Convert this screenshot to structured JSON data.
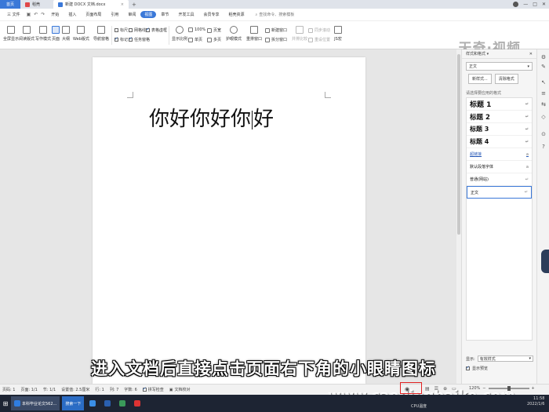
{
  "titlebar": {
    "home_tab": "首页",
    "pdf_tab": "稻壳",
    "doc_tab": "新建 DOCX 文档.docx",
    "close_tab": "×",
    "new_tab": "+",
    "min": "—",
    "max": "□",
    "close": "✕"
  },
  "menubar": {
    "file": "三 文件",
    "items": [
      "开始",
      "插入",
      "页面布局",
      "引用",
      "审阅",
      "视图",
      "章节",
      "开发工具",
      "会员专享",
      "稻壳资源"
    ],
    "active_index": 5,
    "search": "查找命令、搜索模板",
    "right_items": [
      "未同步",
      "协作",
      "分享"
    ]
  },
  "ribbon": {
    "full_screen": "全屏显示",
    "reading_mode": "阅读版式",
    "write_mode": "写作模式",
    "page_view": "页面",
    "outline": "大纲",
    "web_layout": "Web版式",
    "nav_pane": "导航窗格",
    "ruler": "标尺",
    "gridlines": "网格线",
    "table_gridlines": "表格虚框",
    "markup": "标记",
    "task_pane": "任务窗格",
    "zoom": "显示比例",
    "zoom_100": "100%",
    "one_page": "单页",
    "multi_page": "多页",
    "page_width": "页宽",
    "eye_protect": "护眼模式",
    "rearrange": "重排窗口",
    "new_window": "新建窗口",
    "split_window": "拆分窗口",
    "side_by_side": "并排比较",
    "sync_scroll": "同步滚动",
    "reset_pos": "重设位置",
    "macro": "JS宏"
  },
  "watermark": "天奇·视频",
  "document": {
    "text_before": "你好你好你",
    "text_after": "好"
  },
  "subtitle": "进入文档后直接点击页面右下角的小眼睛图标",
  "url_overlay": "www.caodingbaike.com",
  "styles_panel": {
    "title": "样式和格式 ▾",
    "current_style": "正文",
    "new_style": "新样式...",
    "clear_format": "清除格式",
    "list_label": "请选择要应用的格式",
    "items": [
      {
        "label": "标题 1"
      },
      {
        "label": "标题 2"
      },
      {
        "label": "标题 3"
      },
      {
        "label": "标题 4"
      },
      {
        "label": "超链接"
      },
      {
        "label": "默认段落字体"
      },
      {
        "label": "普通(网站)"
      },
      {
        "label": "正文"
      }
    ],
    "return_mark": "↵",
    "para_mark": "a",
    "show_label": "显示:",
    "show_value": "有效样式",
    "preview_label": "显示预览"
  },
  "statusbar": {
    "page_num": "页码: 1",
    "pages": "页面: 1/1",
    "section": "节: 1/1",
    "setting": "设置值: 2.5厘米",
    "row": "行: 1",
    "col": "列: 7",
    "words": "字数: 6",
    "spell": "拼写检查",
    "proof": "文档校对",
    "zoom": "120%"
  },
  "taskbar": {
    "start": "⊞",
    "task1": "本科毕业论文562...",
    "task2": "搜索一下",
    "cpu": "CPU温度",
    "time": "11:58",
    "date": "2022/1/6"
  }
}
